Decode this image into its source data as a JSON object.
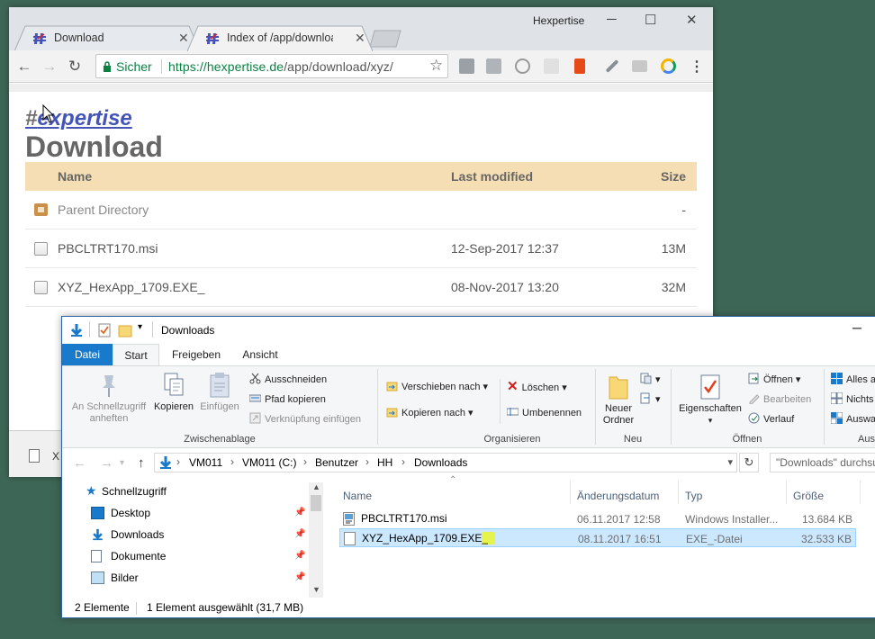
{
  "browser": {
    "tabs": [
      {
        "title": "Download"
      },
      {
        "title": "Index of /app/download/xyz/"
      }
    ],
    "window_user": "Hexpertise",
    "secure_label": "Sicher",
    "url_host": "https://hexpertise.de",
    "url_path": "/app/download/xyz/",
    "download_bar_file": "X"
  },
  "page": {
    "logo_hash": "#",
    "logo_text": "expertise",
    "title": "Download",
    "columns": {
      "name": "Name",
      "modified": "Last modified",
      "size": "Size"
    },
    "parent": {
      "name": "Parent Directory",
      "size": "-"
    },
    "files": [
      {
        "name": "PBCLTRT170.msi",
        "modified": "12-Sep-2017 12:37",
        "size": "13M"
      },
      {
        "name": "XYZ_HexApp_1709.EXE_",
        "modified": "08-Nov-2017 13:20",
        "size": "32M"
      }
    ]
  },
  "explorer": {
    "title": "Downloads",
    "ribbon_tabs": {
      "file": "Datei",
      "start": "Start",
      "share": "Freigeben",
      "view": "Ansicht"
    },
    "clipboard": {
      "pin_line1": "An Schnellzugriff",
      "pin_line2": "anheften",
      "copy": "Kopieren",
      "paste": "Einfügen",
      "cut": "Ausschneiden",
      "copy_path": "Pfad kopieren",
      "paste_shortcut": "Verknüpfung einfügen",
      "label": "Zwischenablage"
    },
    "organize": {
      "move_to": "Verschieben nach",
      "copy_to": "Kopieren nach",
      "delete": "Löschen",
      "rename": "Umbenennen",
      "label": "Organisieren"
    },
    "new": {
      "folder_line1": "Neuer",
      "folder_line2": "Ordner",
      "label": "Neu"
    },
    "open": {
      "properties": "Eigenschaften",
      "open": "Öffnen",
      "edit": "Bearbeiten",
      "history": "Verlauf",
      "label": "Öffnen"
    },
    "select": {
      "all": "Alles a",
      "none": "Nichts",
      "invert": "Auswa",
      "label": "Aus"
    },
    "breadcrumb": [
      "VM011",
      "VM011 (C:)",
      "Benutzer",
      "HH",
      "Downloads"
    ],
    "search_placeholder": "\"Downloads\" durchsuchen",
    "nav": [
      {
        "label": "Schnellzugriff"
      },
      {
        "label": "Desktop"
      },
      {
        "label": "Downloads"
      },
      {
        "label": "Dokumente"
      },
      {
        "label": "Bilder"
      }
    ],
    "columns": {
      "name": "Name",
      "date": "Änderungsdatum",
      "type": "Typ",
      "size": "Größe"
    },
    "files": [
      {
        "name": "PBCLTRT170.msi",
        "date": "06.11.2017 12:58",
        "type": "Windows Installer...",
        "size": "13.684 KB"
      },
      {
        "name_main": "XYZ_HexApp_1709.EXE",
        "name_hl": "_",
        "date": "08.11.2017 16:51",
        "type": "EXE_-Datei",
        "size": "32.533 KB"
      }
    ],
    "status_count": "2 Elemente",
    "status_selection": "1 Element ausgewählt (31,7 MB)"
  }
}
